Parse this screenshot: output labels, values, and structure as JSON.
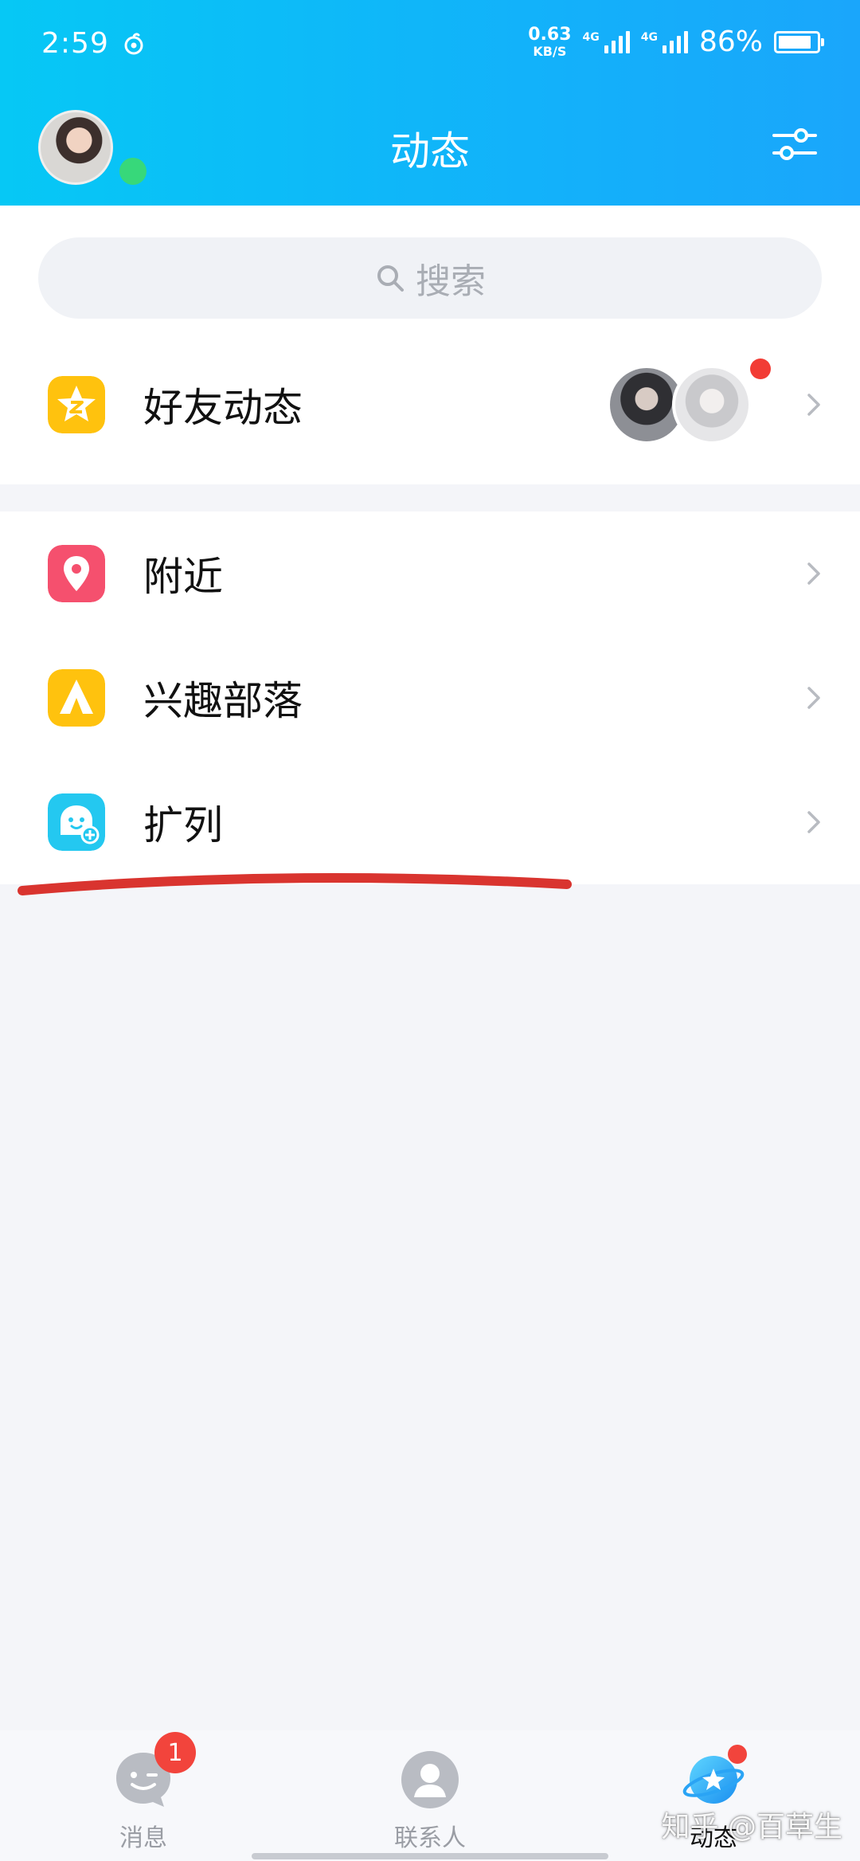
{
  "status_bar": {
    "time": "2:59",
    "net_speed_value": "0.63",
    "net_speed_unit": "KB/S",
    "signal_1_tag": "4G",
    "signal_2_tag": "4G",
    "battery_percent": "86%",
    "battery_level": 0.86
  },
  "header": {
    "title": "动态"
  },
  "search": {
    "placeholder": "搜索"
  },
  "list_groups": [
    {
      "items": [
        {
          "label": "好友动态",
          "icon": "qzone-star-icon",
          "has_new": true
        }
      ]
    },
    {
      "items": [
        {
          "label": "附近",
          "icon": "location-pin-icon"
        },
        {
          "label": "兴趣部落",
          "icon": "tent-icon"
        },
        {
          "label": "扩列",
          "icon": "ghost-plus-icon"
        }
      ]
    }
  ],
  "tabbar": {
    "tabs": [
      {
        "label": "消息",
        "badge": "1",
        "icon": "wink-face-icon"
      },
      {
        "label": "联系人",
        "icon": "person-icon"
      },
      {
        "label": "动态",
        "icon": "planet-star-icon",
        "active": true,
        "has_dot": true
      }
    ]
  },
  "watermark": "知乎 @百草生",
  "colors": {
    "header_gradient_start": "#06c8f5",
    "header_gradient_end": "#1aa6fb",
    "accent_red": "#f2443c",
    "online_green": "#37d87a"
  }
}
